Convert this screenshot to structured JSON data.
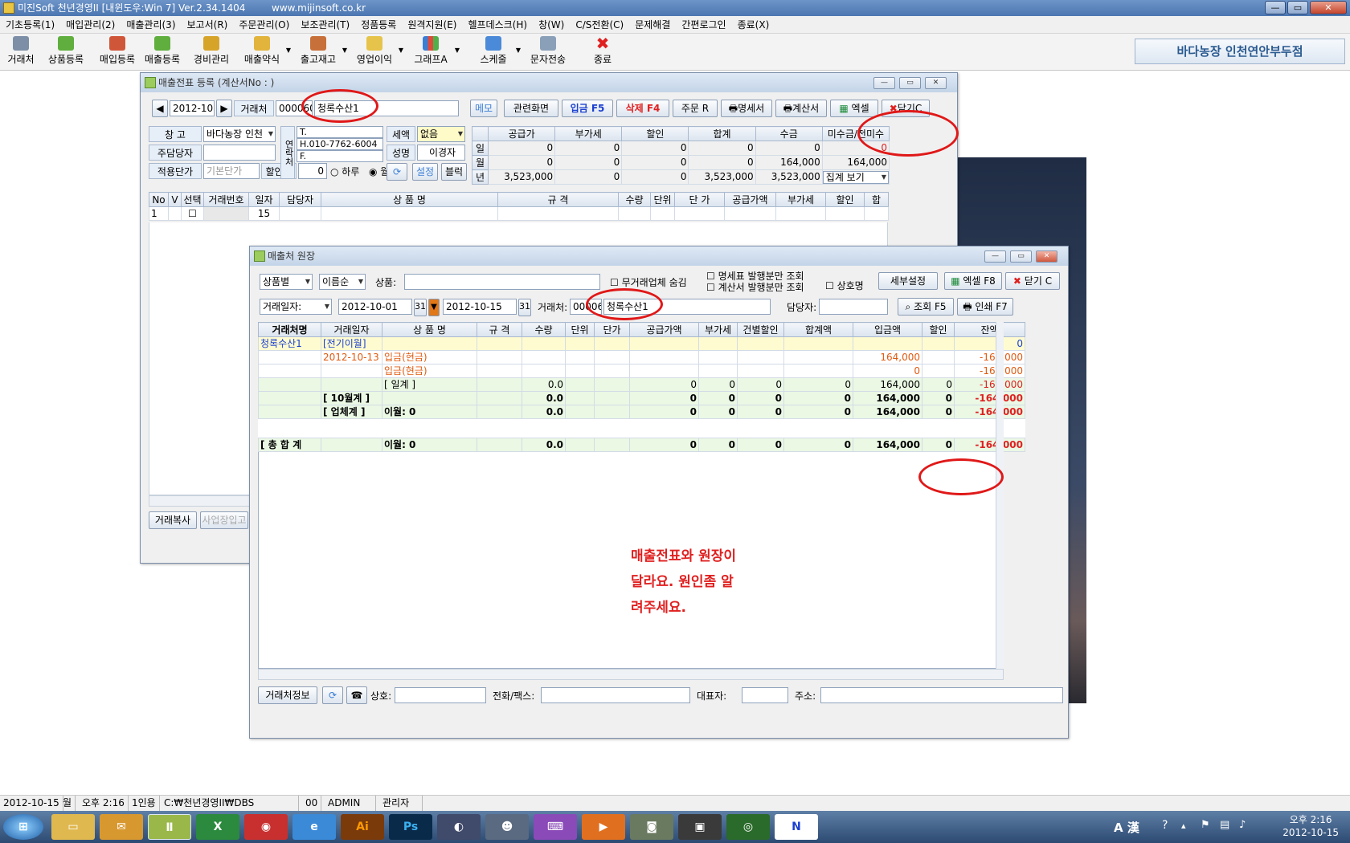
{
  "app": {
    "title": "미진Soft 천년경영II [내윈도우:Win 7] Ver.2.34.1404",
    "url": "www.mijinsoft.co.kr",
    "shop_name": "바다농장 인천연안부두점"
  },
  "menu": [
    "기초등록(1)",
    "매입관리(2)",
    "매출관리(3)",
    "보고서(R)",
    "주문관리(O)",
    "보조관리(T)",
    "정품등록",
    "원격지원(E)",
    "헬프데스크(H)",
    "창(W)",
    "C/S전환(C)",
    "문제해결",
    "간편로그인",
    "종료(X)"
  ],
  "toolbar": [
    "거래처",
    "상품등록",
    "매입등록",
    "매출등록",
    "경비관리",
    "매출약식",
    "출고재고",
    "영업이익",
    "그래프A",
    "스케줄",
    "문자전송",
    "종료"
  ],
  "icons": {
    "toolbar_icons": [
      "building-icon",
      "box-add-icon",
      "purchase-icon",
      "sales-icon",
      "money-icon",
      "sales-quick-icon",
      "stock-icon",
      "profit-icon",
      "chart-icon",
      "calendar-icon",
      "sms-icon",
      "close-x-icon"
    ]
  },
  "colors": {
    "accent_red": "#e02020",
    "header_blue": "#c3d4e8",
    "total_green": "#eaf8e4",
    "carry_yellow": "#fffbd0"
  },
  "sales": {
    "title": "매출전표 등록 (계산서No : )",
    "month": "2012-10",
    "customer_label": "거래처",
    "customer_code": "000060",
    "customer_name": "청록수산1",
    "memo": "메모",
    "buttons": [
      "관련화면",
      "입금 F5",
      "삭제 F4",
      "주문 R",
      "명세서",
      "계산서",
      "엑셀",
      "닫기C"
    ],
    "warehouse_label": "창  고",
    "warehouse": "바다농장 인천",
    "manager_label": "주담당자",
    "price_label": "적용단가",
    "price_value": "기본단가",
    "discount_label": "할인율",
    "discount_value": "0",
    "radio_day": "하루",
    "radio_month": "월",
    "phone_side": "연락처",
    "phone_t": "T.",
    "phone_h": "H.010-7762-6004",
    "phone_f": "F.",
    "tax_label": "세액",
    "tax_value": "없음",
    "name_label": "성명",
    "name_value": "이경자",
    "set_btn": "설정",
    "block_btn": "블럭",
    "summary_headers": [
      "공급가",
      "부가세",
      "할인",
      "합계",
      "수금",
      "미수금/전미수"
    ],
    "summary_rows": [
      {
        "label": "일",
        "values": [
          "0",
          "0",
          "0",
          "0",
          "0",
          "0"
        ]
      },
      {
        "label": "월",
        "values": [
          "0",
          "0",
          "0",
          "0",
          "164,000",
          "164,000"
        ]
      },
      {
        "label": "년",
        "values": [
          "3,523,000",
          "0",
          "0",
          "3,523,000",
          "3,523,000",
          ""
        ]
      }
    ],
    "summary_select": "집계 보기",
    "grid_headers": [
      "No",
      "V",
      "선택",
      "거래번호",
      "일자",
      "담당자",
      "상 품 명",
      "규 격",
      "수량",
      "단위",
      "단 가",
      "공급가액",
      "부가세",
      "할인",
      "합"
    ],
    "grid_row": {
      "no": "1",
      "day": "15"
    },
    "bottom_buttons": [
      "거래복사",
      "사업장입고"
    ]
  },
  "ledger": {
    "title": "매출처 원장",
    "sort1": "상품별",
    "sort2": "이름순",
    "product_label": "상품:",
    "hide_label": "무거래업체 숨김",
    "stmt_only": "명세표 발행분만 조회",
    "invoice_only": "계산서 발행분만 조회",
    "shop_name_chk": "상호명",
    "detail_btn": "세부설정",
    "excel_btn": "엑셀 F8",
    "close_btn": "닫기 C",
    "date_type": "거래일자:",
    "date_from": "2012-10-01",
    "date_to": "2012-10-15",
    "cal_icon": "31",
    "customer_label": "거래처:",
    "customer_code": "000060",
    "customer_name": "청록수산1",
    "manager_label": "담당자:",
    "search_btn": "조회 F5",
    "print_btn": "인쇄 F7",
    "headers": [
      "거래처명",
      "거래일자",
      "상 품 명",
      "규 격",
      "수량",
      "단위",
      "단가",
      "공급가액",
      "부가세",
      "건별할인",
      "합계액",
      "입금액",
      "할인",
      "잔액"
    ],
    "rows": [
      {
        "cls": "carry",
        "cells": [
          "청록수산1",
          "[전기이월]",
          "",
          "",
          "",
          "",
          "",
          "",
          "",
          "",
          "",
          "",
          "",
          "0"
        ]
      },
      {
        "cls": "pay",
        "cells": [
          "",
          "2012-10-13",
          "입금(현금)",
          "",
          "",
          "",
          "",
          "",
          "",
          "",
          "",
          "164,000",
          "",
          "-164,000"
        ]
      },
      {
        "cls": "pay2",
        "cells": [
          "",
          "",
          "입금(현금)",
          "",
          "",
          "",
          "",
          "",
          "",
          "",
          "",
          "0",
          "",
          "-164,000"
        ]
      },
      {
        "cls": "day",
        "cells": [
          "",
          "",
          "[ 일계 ]",
          "",
          "0.0",
          "",
          "",
          "0",
          "0",
          "0",
          "0",
          "164,000",
          "0",
          "-164,000"
        ]
      },
      {
        "cls": "sub",
        "cells": [
          "",
          "[ 10월계 ]",
          "",
          "",
          "0.0",
          "",
          "",
          "0",
          "0",
          "0",
          "0",
          "164,000",
          "0",
          "-164,000"
        ]
      },
      {
        "cls": "sub",
        "cells": [
          "",
          "[ 업체계 ]",
          "이월: 0",
          "",
          "0.0",
          "",
          "",
          "0",
          "0",
          "0",
          "0",
          "164,000",
          "0",
          "-164,000"
        ]
      }
    ],
    "total_row": [
      "[ 총 합 계",
      "",
      "이월: 0",
      "",
      "0.0",
      "",
      "",
      "0",
      "0",
      "0",
      "0",
      "164,000",
      "0",
      "-164,000"
    ],
    "note_lines": [
      "매출전표와 원장이",
      "달라요. 원인좀 알",
      "려주세요."
    ],
    "footer_info_btn": "거래처정보",
    "footer_labels": [
      "상호:",
      "전화/팩스:",
      "대표자:",
      "주소:"
    ]
  },
  "status": [
    "2012-10-15",
    "월",
    "오후 2:16",
    "1인용",
    "C:₩천년경영II₩DBS",
    "00",
    "ADMIN",
    "관리자"
  ],
  "taskbar": {
    "time": "오후 2:16",
    "date": "2012-10-15",
    "ime": "A 漢"
  }
}
